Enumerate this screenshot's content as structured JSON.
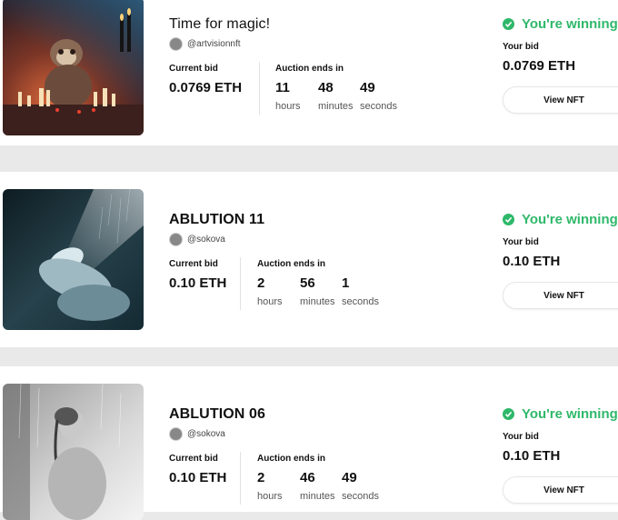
{
  "labels": {
    "current_bid": "Current bid",
    "auction_ends": "Auction ends in",
    "hours": "hours",
    "minutes": "minutes",
    "seconds": "seconds",
    "winning": "You're winning!",
    "your_bid": "Your bid",
    "view_nft": "View NFT"
  },
  "colors": {
    "accent_green": "#2fb86a"
  },
  "items": [
    {
      "title": "Time for magic!",
      "creator": "@artvisionnft",
      "current_bid": "0.0769 ETH",
      "hours": "11",
      "minutes": "48",
      "seconds": "49",
      "your_bid": "0.0769 ETH"
    },
    {
      "title": "ABLUTION 11",
      "creator": "@sokova",
      "current_bid": "0.10 ETH",
      "hours": "2",
      "minutes": "56",
      "seconds": "1",
      "your_bid": "0.10 ETH"
    },
    {
      "title": "ABLUTION 06",
      "creator": "@sokova",
      "current_bid": "0.10 ETH",
      "hours": "2",
      "minutes": "46",
      "seconds": "49",
      "your_bid": "0.10 ETH"
    }
  ]
}
